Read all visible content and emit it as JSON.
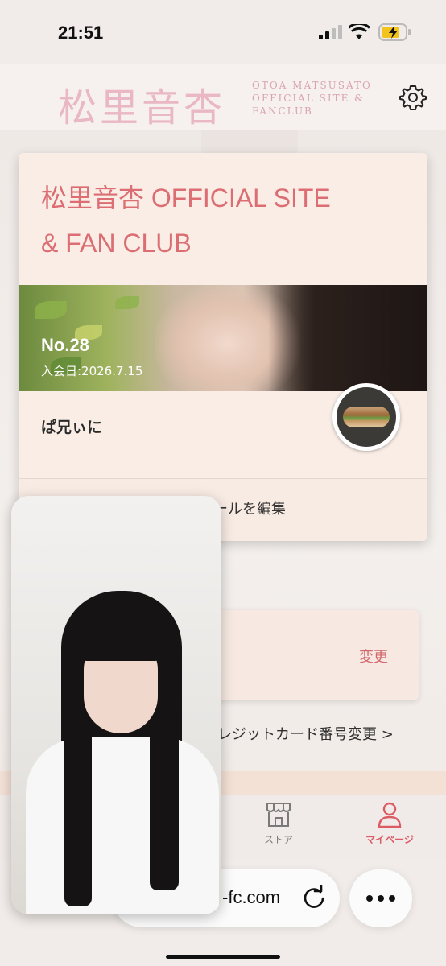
{
  "status_bar": {
    "time": "21:51"
  },
  "header": {
    "logo_jp": "松里音杏",
    "logo_en_line1": "OTOA MATSUSATO",
    "logo_en_line2": "OFFICIAL SITE &",
    "logo_en_line3": "FANCLUB"
  },
  "member_card": {
    "title_line1": "松里音杏 OFFICIAL SITE",
    "title_line2": "& FAN CLUB",
    "member_no": "No.28",
    "join_date": "入会日:2026.7.15",
    "username": "ぱ兄ぃに",
    "edit_profile_visible": "ールを編集"
  },
  "plan": {
    "change_label": "変更"
  },
  "credit_link": "レジットカード番号変更 >",
  "tabs": [
    {
      "label": "ストア",
      "icon": "store-icon"
    },
    {
      "label": "マイページ",
      "icon": "person-icon",
      "active": true
    }
  ],
  "browser": {
    "url_visible": "-fc.com"
  },
  "colors": {
    "accent": "#dc6e73",
    "logo_pink": "#e9b7c5",
    "card_bg": "#f9ede6"
  }
}
